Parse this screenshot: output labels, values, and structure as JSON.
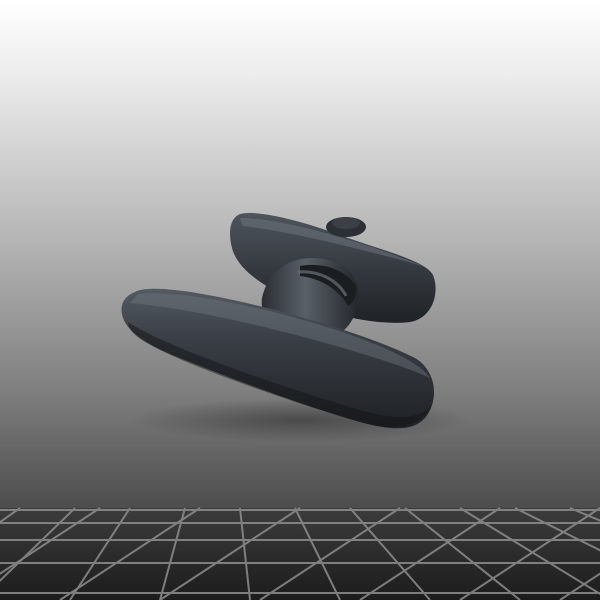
{
  "scene": {
    "subject": "t-handle-icon",
    "colors": {
      "background_top": "#ffffff",
      "background_mid": "#a6a6a6",
      "background_bottom": "#3a3a3a",
      "floor": "#2b2b2b",
      "floor_lines": "#8e8e8e",
      "handle_body": "#2f333a",
      "handle_highlight": "#6c727b",
      "handle_shadow": "#151719"
    }
  }
}
